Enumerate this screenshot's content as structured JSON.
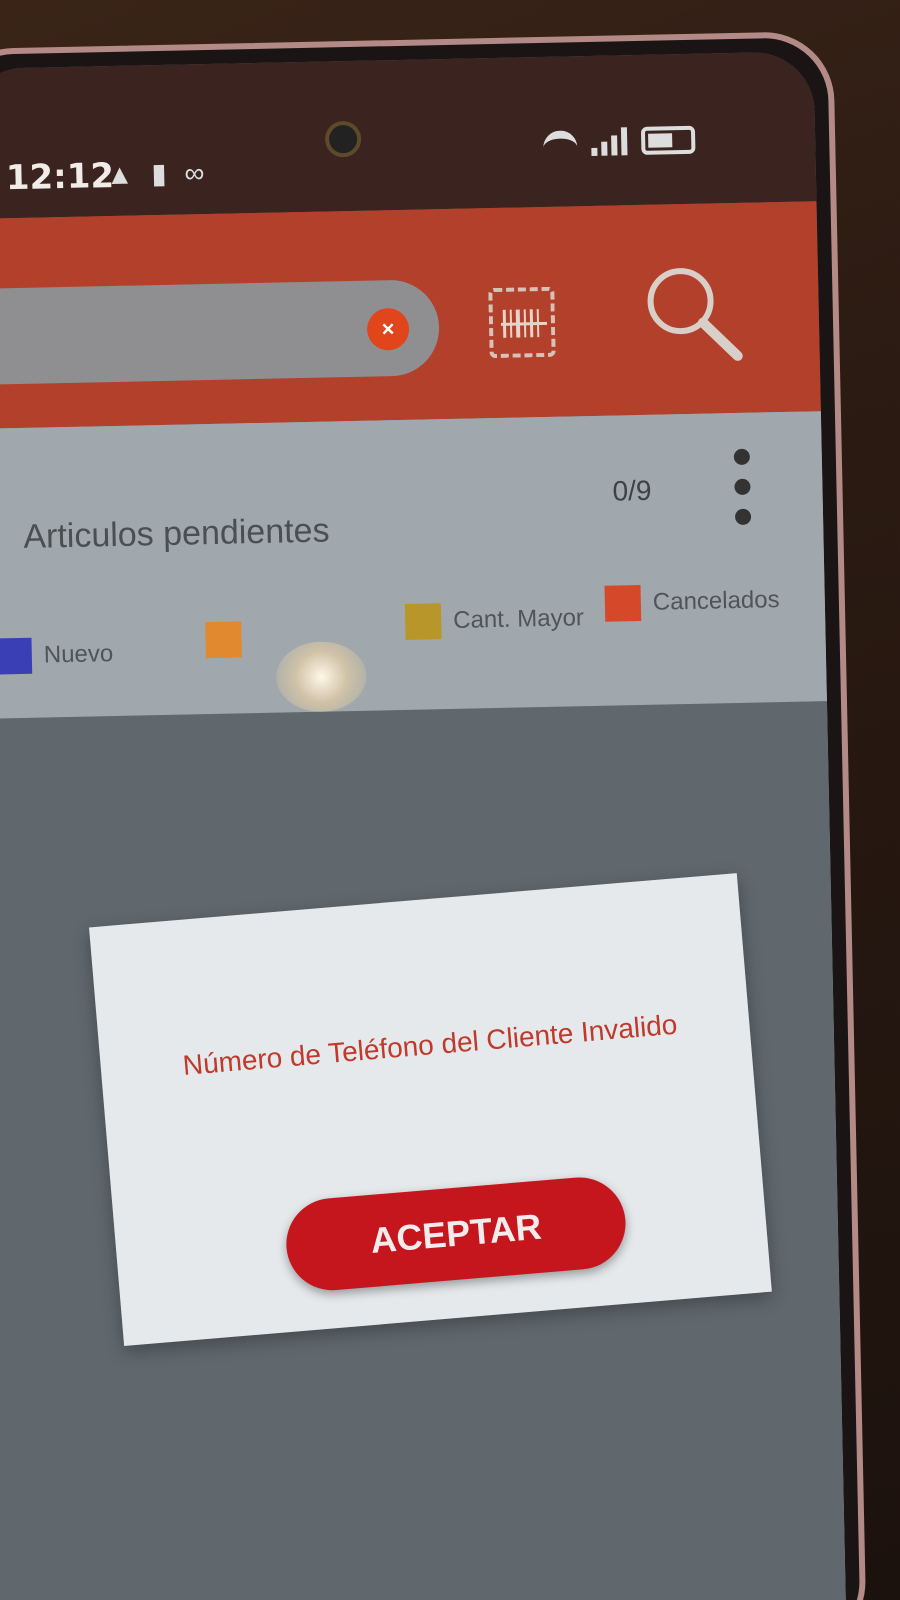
{
  "status_bar": {
    "time": "12:12",
    "left_icons": [
      "notification-icon",
      "sim-icon",
      "voicemail-icon"
    ],
    "right_icons": [
      "wifi-icon",
      "signal-icon",
      "battery-icon"
    ]
  },
  "header": {
    "search": {
      "value": "",
      "placeholder": ""
    },
    "clear_label": "×",
    "actions": [
      "barcode-scanner-icon",
      "search-icon"
    ],
    "accent_color": "#b2402a"
  },
  "pending": {
    "title": "Articulos pendientes",
    "count": "0/9",
    "legend": [
      {
        "label": "Nuevo",
        "color": "#3a3fb5"
      },
      {
        "label": "",
        "color": "#e0892e"
      },
      {
        "label": "Cant. Mayor",
        "color": "#b8962a"
      },
      {
        "label": "Cancelados",
        "color": "#d5482a"
      }
    ]
  },
  "dialog": {
    "message": "Número de Teléfono del Cliente Invalido",
    "accept_label": "ACEPTAR",
    "button_color": "#c4161c"
  }
}
